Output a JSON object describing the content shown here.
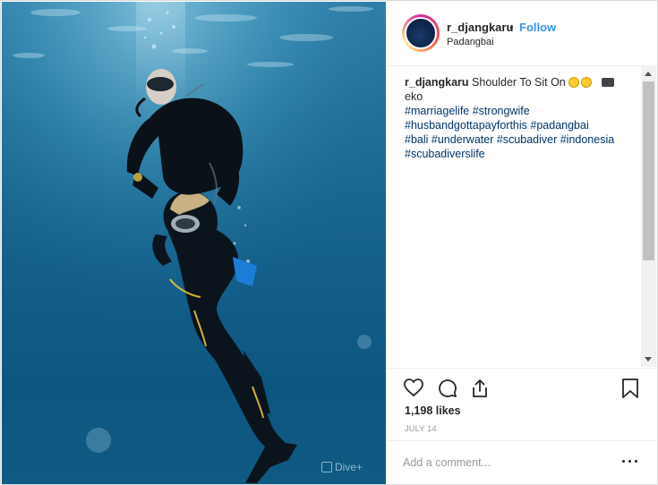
{
  "post": {
    "username": "r_djangkaru",
    "separator": "•",
    "follow_label": "Follow",
    "location": "Padangbai",
    "caption": {
      "user": "r_djangkaru",
      "text": "Shoulder To Sit On",
      "continuation": "eko",
      "hashtags": [
        "#marriagelife #strongwife",
        "#husbandgottapayforthis #padangbai",
        "#bali #underwater #scubadiver #indonesia",
        "#scubadiverslife"
      ]
    },
    "likes": "1,198 likes",
    "date": "JULY 14",
    "comment_placeholder": "Add a comment...",
    "watermark": "Dive+"
  },
  "icons": {
    "like": "heart-icon",
    "comment": "comment-bubble-icon",
    "share": "share-icon",
    "save": "bookmark-icon",
    "more": "more-options-icon"
  },
  "colors": {
    "link": "#3897f0",
    "hashtag": "#003569",
    "muted": "#999999"
  }
}
